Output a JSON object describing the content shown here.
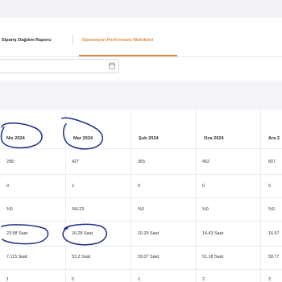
{
  "tabs": {
    "tab1_label": "Sipariş Dağılım Raporu",
    "tab2_label": "Operasyon Performans Metrikleri"
  },
  "table": {
    "columns": [
      "Nis 2024",
      "Mar 2024",
      "Şub 2024",
      "Oca 2024",
      "Ara 2"
    ],
    "rows": [
      [
        "298",
        "427",
        "365",
        "452",
        "807"
      ],
      [
        "0",
        "1",
        "0",
        "0",
        "0"
      ],
      [
        "%0",
        "%0.23",
        "%0",
        "%0",
        "%0"
      ],
      [
        "23.58 Saat",
        "16.28 Saat",
        "20.25 Saat",
        "14.43 Saat",
        "16.57"
      ],
      [
        "7.115 Saat",
        "53.2 Saat",
        "59.07 Saat",
        "51.18 Saat",
        "58.77"
      ],
      [
        "1",
        "0",
        "1",
        "2",
        "3"
      ]
    ]
  },
  "colors": {
    "accent": "#e08a3c",
    "annotation_ink": "#1f2f8a"
  },
  "icons": {
    "date_field": "calendar-icon"
  }
}
